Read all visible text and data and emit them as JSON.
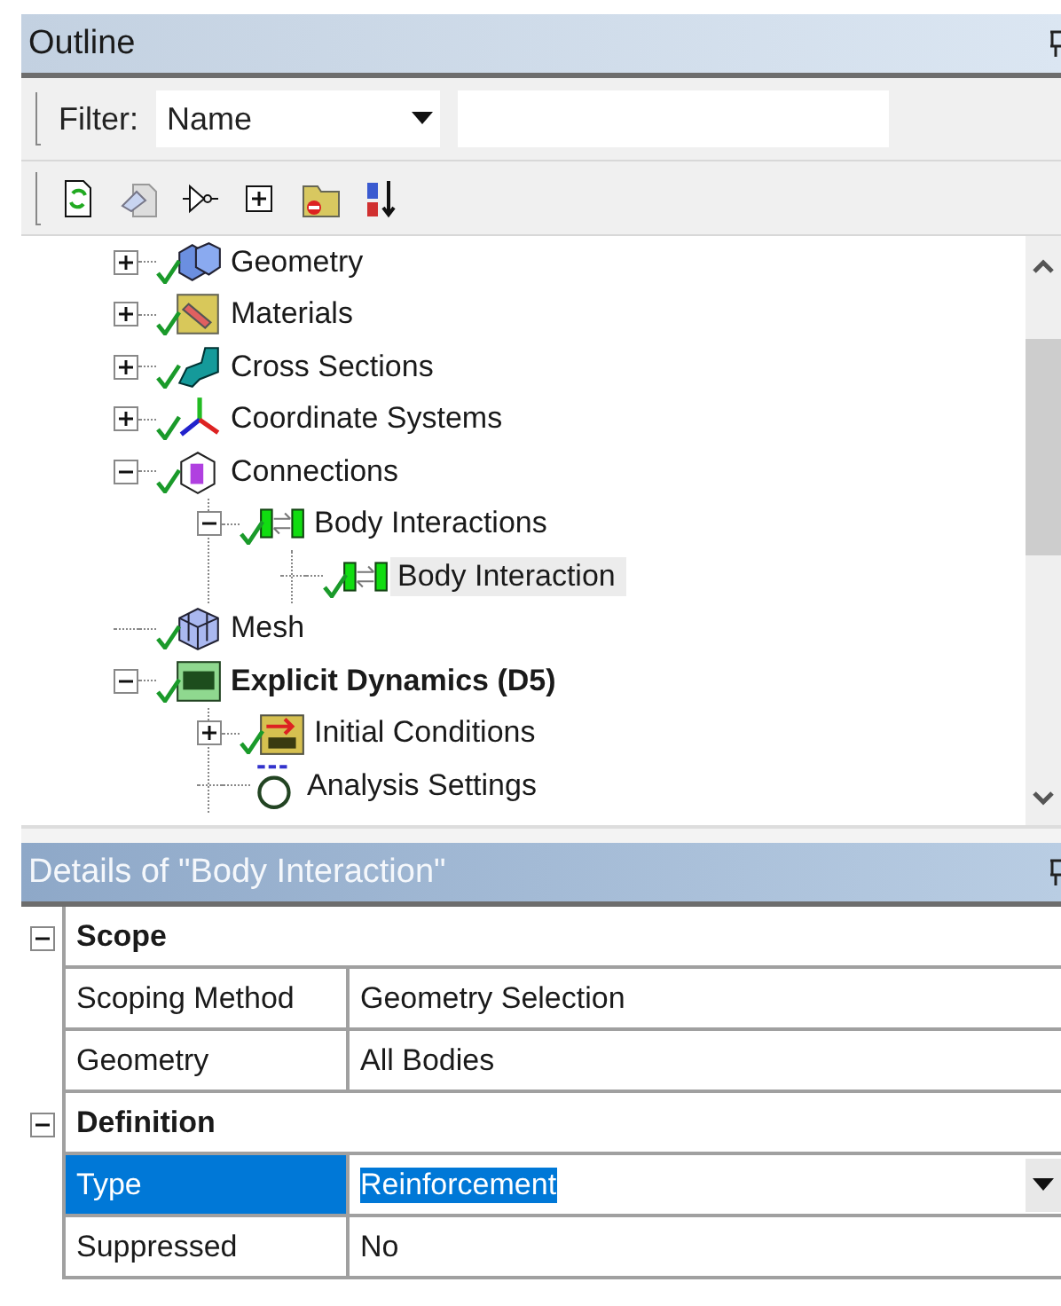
{
  "outline": {
    "title": "Outline",
    "filter": {
      "label": "Filter:",
      "value": "Name"
    },
    "tree": [
      {
        "label": "Geometry",
        "kind": "geometry",
        "expanded": false,
        "done": true,
        "selected": false,
        "bold": false
      },
      {
        "label": "Materials",
        "kind": "materials",
        "expanded": false,
        "done": true,
        "selected": false,
        "bold": false
      },
      {
        "label": "Cross Sections",
        "kind": "sections",
        "expanded": false,
        "done": true,
        "selected": false,
        "bold": false
      },
      {
        "label": "Coordinate Systems",
        "kind": "axes",
        "expanded": false,
        "done": true,
        "selected": false,
        "bold": false
      },
      {
        "label": "Connections",
        "kind": "connections",
        "expanded": true,
        "done": true,
        "selected": false,
        "bold": false,
        "children": [
          {
            "label": "Body Interactions",
            "kind": "interaction",
            "expanded": true,
            "done": true,
            "selected": false,
            "bold": false,
            "children": [
              {
                "label": "Body Interaction",
                "kind": "interaction",
                "done": true,
                "selected": true,
                "bold": false
              }
            ]
          }
        ]
      },
      {
        "label": "Mesh",
        "kind": "mesh",
        "done": true,
        "selected": false,
        "bold": false
      },
      {
        "label": "Explicit Dynamics (D5)",
        "kind": "analysis",
        "expanded": true,
        "done": true,
        "selected": false,
        "bold": true,
        "children": [
          {
            "label": "Initial Conditions",
            "kind": "conditions",
            "expanded": false,
            "done": true,
            "selected": false,
            "bold": false
          },
          {
            "label": "Analysis Settings",
            "kind": "settings",
            "done": false,
            "selected": false,
            "bold": false
          }
        ]
      }
    ]
  },
  "details": {
    "title": "Details of \"Body Interaction\"",
    "groups": [
      {
        "title": "Scope",
        "expanded": true,
        "rows": [
          {
            "label": "Scoping Method",
            "value": "Geometry Selection",
            "kind": "text",
            "selected": false
          },
          {
            "label": "Geometry",
            "value": "All Bodies",
            "kind": "text",
            "selected": false
          }
        ]
      },
      {
        "title": "Definition",
        "expanded": true,
        "rows": [
          {
            "label": "Type",
            "value": "Reinforcement",
            "kind": "dropdown",
            "selected": true
          },
          {
            "label": "Suppressed",
            "value": "No",
            "kind": "text",
            "selected": false
          }
        ]
      }
    ]
  }
}
